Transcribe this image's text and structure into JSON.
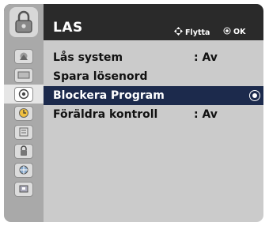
{
  "menu_title": "LAS",
  "hints": {
    "move_label": "Flytta",
    "ok_label": "OK"
  },
  "sidebar": [
    {
      "icon": "picture-icon",
      "active": false
    },
    {
      "icon": "screen-icon",
      "active": false
    },
    {
      "icon": "sound-icon",
      "active": true
    },
    {
      "icon": "clock-icon",
      "active": false
    },
    {
      "icon": "option-icon",
      "active": false
    },
    {
      "icon": "lock-icon",
      "active": false
    },
    {
      "icon": "input-icon",
      "active": false
    },
    {
      "icon": "usb-icon",
      "active": false
    }
  ],
  "items": [
    {
      "label": "Lås system",
      "value": ": Av"
    },
    {
      "label": "Spara lösenord",
      "value": ""
    },
    {
      "label": "Blockera Program",
      "value": "",
      "selected": true
    },
    {
      "label": "Föräldra kontroll",
      "value": ": Av"
    }
  ],
  "colors": {
    "selection": "#1c2a4c",
    "header": "#2a2a2a",
    "panel": "#cbcbcb"
  }
}
